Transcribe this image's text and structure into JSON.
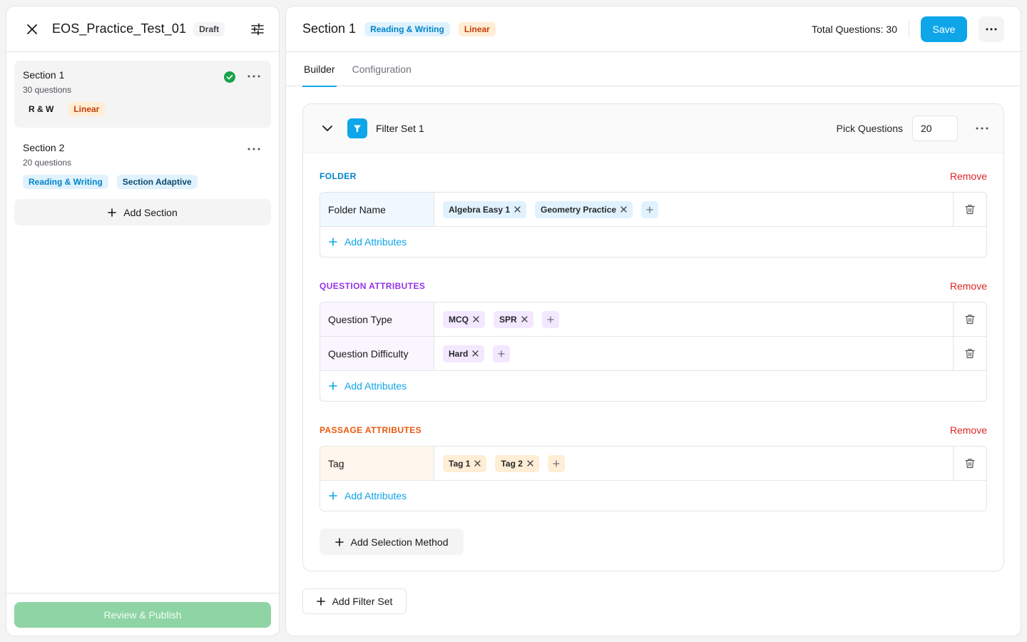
{
  "sidebar": {
    "test_title": "EOS_Practice_Test_01",
    "status": "Draft",
    "sections": [
      {
        "name": "Section 1",
        "count": "30 questions",
        "tags": [
          "R & W",
          "Linear"
        ],
        "complete": true
      },
      {
        "name": "Section 2",
        "count": "20 questions",
        "tags": [
          "Reading & Writing",
          "Section Adaptive"
        ],
        "complete": false
      }
    ],
    "add_section_label": "Add Section",
    "publish_label": "Review & Publish"
  },
  "header": {
    "title": "Section 1",
    "tags": [
      "Reading & Writing",
      "Linear"
    ],
    "total_questions": "Total Questions: 30",
    "save_label": "Save"
  },
  "tabs": [
    {
      "label": "Builder",
      "active": true
    },
    {
      "label": "Configuration",
      "active": false
    }
  ],
  "filter_set": {
    "name": "Filter Set 1",
    "pick_label": "Pick Questions",
    "pick_value": "20",
    "groups": {
      "folder": {
        "title": "FOLDER",
        "remove_label": "Remove",
        "rows": [
          {
            "label": "Folder Name",
            "values": [
              "Algebra Easy 1",
              "Geometry Practice"
            ]
          }
        ],
        "add_label": "Add Attributes"
      },
      "question": {
        "title": "QUESTION ATTRIBUTES",
        "remove_label": "Remove",
        "rows": [
          {
            "label": "Question Type",
            "values": [
              "MCQ",
              "SPR"
            ]
          },
          {
            "label": "Question Difficulty",
            "values": [
              "Hard"
            ]
          }
        ],
        "add_label": "Add Attributes"
      },
      "passage": {
        "title": "PASSAGE ATTRIBUTES",
        "remove_label": "Remove",
        "rows": [
          {
            "label": "Tag",
            "values": [
              "Tag 1",
              "Tag 2"
            ]
          }
        ],
        "add_label": "Add Attributes"
      }
    },
    "add_method_label": "Add Selection Method"
  },
  "add_filter_set_label": "Add Filter Set",
  "colors": {
    "accent": "#0ea5e9",
    "success": "#16a34a",
    "danger": "#dc2626",
    "folder": "#0284c7",
    "question": "#9333ea",
    "passage": "#ea580c"
  }
}
